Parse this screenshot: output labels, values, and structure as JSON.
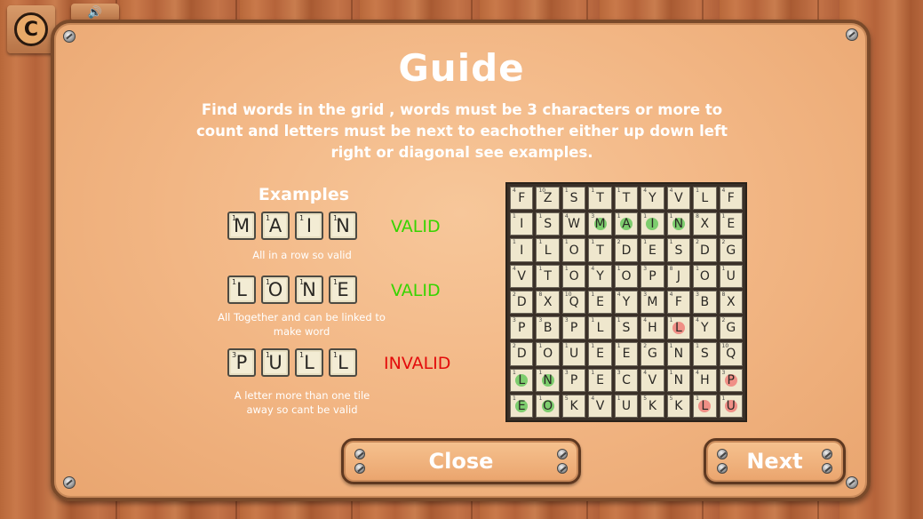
{
  "top_icons": [
    {
      "icon": "c-logo-icon",
      "glyph": "C"
    },
    {
      "icon": "sound-icon",
      "glyph": "🔊"
    }
  ],
  "title": "Guide",
  "intro": "Find words in the grid , words must be 3 characters or more to count and letters must be next to eachother either up down left right or diagonal see examples.",
  "examples_heading": "Examples",
  "examples": [
    {
      "tiles": [
        {
          "ch": "M",
          "pts": "1"
        },
        {
          "ch": "A",
          "pts": "1"
        },
        {
          "ch": "I",
          "pts": "1"
        },
        {
          "ch": "N",
          "pts": "1"
        }
      ],
      "verdict": "VALID",
      "caption": "All in a row so valid"
    },
    {
      "tiles": [
        {
          "ch": "L",
          "pts": "1"
        },
        {
          "ch": "O",
          "pts": "1"
        },
        {
          "ch": "N",
          "pts": "1"
        },
        {
          "ch": "E",
          "pts": "1"
        }
      ],
      "verdict": "VALID",
      "caption": "All Together and can be linked to make word"
    },
    {
      "tiles": [
        {
          "ch": "P",
          "pts": "3"
        },
        {
          "ch": "U",
          "pts": "1"
        },
        {
          "ch": "L",
          "pts": "1"
        },
        {
          "ch": "L",
          "pts": "1"
        }
      ],
      "verdict": "INVALID",
      "caption": "A letter more than one tile away so cant be valid"
    }
  ],
  "colors": {
    "valid": "#37d400",
    "invalid": "#e30b0b",
    "green_highlight": "#3fbf3a",
    "red_highlight": "#f06060"
  },
  "grid": [
    [
      "F",
      "Z",
      "S",
      "T",
      "T",
      "Y",
      "V",
      "L",
      "F"
    ],
    [
      "I",
      "S",
      "W",
      "M",
      "A",
      "I",
      "N",
      "X",
      "E"
    ],
    [
      "I",
      "L",
      "O",
      "T",
      "D",
      "E",
      "S",
      "D",
      "G"
    ],
    [
      "V",
      "T",
      "O",
      "Y",
      "O",
      "P",
      "J",
      "O",
      "U"
    ],
    [
      "D",
      "X",
      "Q",
      "E",
      "Y",
      "M",
      "F",
      "B",
      "X"
    ],
    [
      "P",
      "B",
      "P",
      "L",
      "S",
      "H",
      "L",
      "Y",
      "G"
    ],
    [
      "D",
      "O",
      "U",
      "E",
      "E",
      "G",
      "N",
      "S",
      "Q"
    ],
    [
      "L",
      "N",
      "P",
      "E",
      "C",
      "V",
      "N",
      "H",
      "P"
    ],
    [
      "E",
      "O",
      "K",
      "V",
      "U",
      "K",
      "K",
      "L",
      "U"
    ]
  ],
  "grid_points": [
    [
      "4",
      "10",
      "1",
      "1",
      "1",
      "4",
      "4",
      "1",
      "4"
    ],
    [
      "1",
      "1",
      "4",
      "3",
      "1",
      "1",
      "1",
      "8",
      "1"
    ],
    [
      "1",
      "1",
      "1",
      "1",
      "2",
      "1",
      "1",
      "2",
      "2"
    ],
    [
      "4",
      "1",
      "1",
      "4",
      "1",
      "3",
      "8",
      "1",
      "1"
    ],
    [
      "2",
      "8",
      "10",
      "1",
      "4",
      "3",
      "4",
      "3",
      "8"
    ],
    [
      "3",
      "3",
      "3",
      "1",
      "1",
      "4",
      "1",
      "4",
      "2"
    ],
    [
      "2",
      "1",
      "1",
      "1",
      "1",
      "2",
      "1",
      "1",
      "10"
    ],
    [
      "1",
      "1",
      "3",
      "1",
      "3",
      "4",
      "1",
      "4",
      "3"
    ],
    [
      "1",
      "1",
      "5",
      "4",
      "1",
      "5",
      "5",
      "1",
      "1"
    ]
  ],
  "highlights": [
    {
      "row": 1,
      "col": 3,
      "color": "green"
    },
    {
      "row": 1,
      "col": 4,
      "color": "green"
    },
    {
      "row": 1,
      "col": 5,
      "color": "green"
    },
    {
      "row": 1,
      "col": 6,
      "color": "green"
    },
    {
      "row": 7,
      "col": 0,
      "color": "green"
    },
    {
      "row": 7,
      "col": 1,
      "color": "green"
    },
    {
      "row": 8,
      "col": 0,
      "color": "green"
    },
    {
      "row": 8,
      "col": 1,
      "color": "green"
    },
    {
      "row": 5,
      "col": 6,
      "color": "red"
    },
    {
      "row": 7,
      "col": 8,
      "color": "red"
    },
    {
      "row": 8,
      "col": 7,
      "color": "red"
    },
    {
      "row": 8,
      "col": 8,
      "color": "red"
    }
  ],
  "buttons": {
    "close": "Close",
    "next": "Next"
  }
}
